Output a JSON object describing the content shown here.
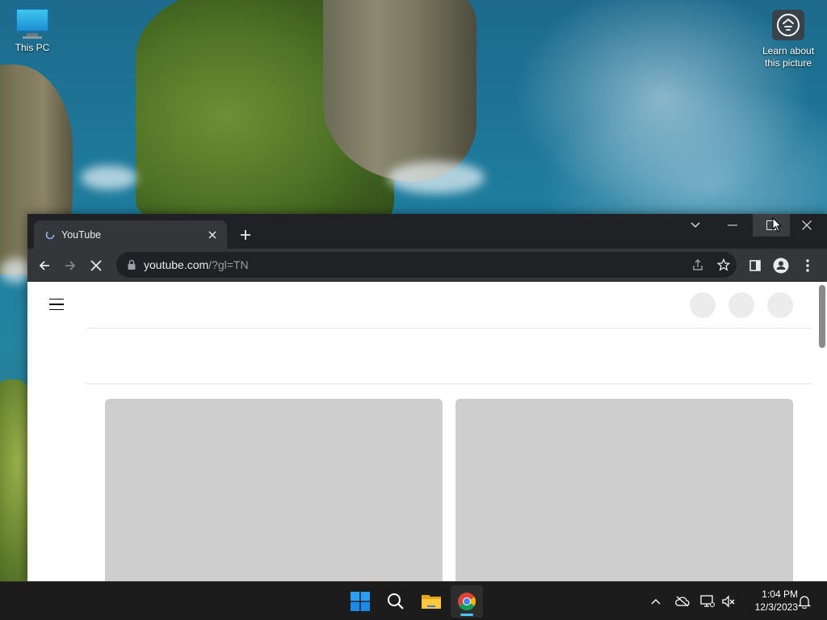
{
  "desktop": {
    "icons": [
      {
        "label": "This PC",
        "icon": "computer-monitor-icon"
      },
      {
        "label": "Learn about this picture",
        "icon": "camera-info-icon"
      }
    ]
  },
  "browser": {
    "tab": {
      "title": "YouTube",
      "favicon": "loading-favicon"
    },
    "window_controls": [
      "tab-search",
      "minimize",
      "maximize",
      "close"
    ],
    "toolbar": {
      "url_host": "youtube.com",
      "url_rest": "/?gl=TN",
      "loading": true
    }
  },
  "taskbar": {
    "apps": [
      "start",
      "search",
      "file-explorer",
      "chrome"
    ],
    "active_app": "chrome",
    "tray": [
      "show-hidden-icons",
      "onedrive-offline",
      "network",
      "volume-muted",
      "notifications"
    ],
    "time": "1:04 PM",
    "date": "12/3/2023"
  },
  "colors": {
    "titlebar": "#202124",
    "toolbar": "#35363a",
    "taskbar": "#1c1c1c",
    "placeholder": "#cecece",
    "accent": "#4cc2ff"
  }
}
